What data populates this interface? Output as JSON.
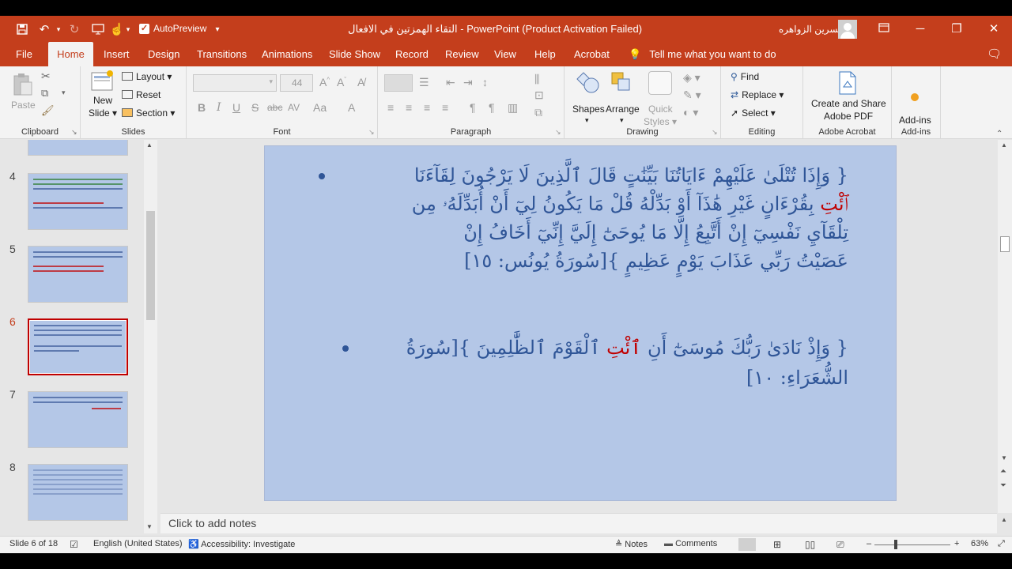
{
  "titlebar": {
    "autopreview_label": "AutoPreview",
    "document_title": "التقاء الهمزتين في الافعال  -  PowerPoint (Product Activation Failed)",
    "user_name": "نسرين الزواهره"
  },
  "tabs": [
    "File",
    "Home",
    "Insert",
    "Design",
    "Transitions",
    "Animations",
    "Slide Show",
    "Record",
    "Review",
    "View",
    "Help",
    "Acrobat"
  ],
  "tell_me": "Tell me what you want to do",
  "ribbon": {
    "clipboard": {
      "label": "Clipboard",
      "paste": "Paste"
    },
    "slides": {
      "label": "Slides",
      "new_slide": "New",
      "new_slide2": "Slide",
      "layout": "Layout",
      "reset": "Reset",
      "section": "Section"
    },
    "font": {
      "label": "Font",
      "size": "44",
      "bold": "B",
      "italic": "I",
      "underline": "U",
      "strike": "S",
      "shadow": "abc",
      "spacing": "AV",
      "case": "Aa",
      "color": "A"
    },
    "paragraph": {
      "label": "Paragraph"
    },
    "drawing": {
      "label": "Drawing",
      "shapes": "Shapes",
      "arrange": "Arrange",
      "quick_styles": "Quick",
      "quick_styles2": "Styles"
    },
    "editing": {
      "label": "Editing",
      "find": "Find",
      "replace": "Replace",
      "select": "Select"
    },
    "adobe": {
      "label": "Adobe Acrobat",
      "create_share": "Create and Share",
      "adobe_pdf": "Adobe PDF"
    },
    "addins": {
      "label": "Add-ins",
      "addins_btn": "Add-ins"
    }
  },
  "thumbnails": [
    {
      "num": "4"
    },
    {
      "num": "5"
    },
    {
      "num": "6"
    },
    {
      "num": "7"
    },
    {
      "num": "8"
    }
  ],
  "slide": {
    "verse1_l1": "{ وَإِذَا تُتْلَىٰ عَلَيْهِمْ ءَايَاتُنَا بَيِّنَٰتٍ قَالَ ٱلَّذِينَ لَا يَرْجُونَ لِقَآءَنَا",
    "verse1_l2_red": "ٱئْتِ",
    "verse1_l2": "بِقُرْءَانٍ غَيْرِ هَٰذَآ أَوْ بَدِّلْهُ قُلْ مَا يَكُونُ لِيٓ أَنْ أُبَدِّلَهُۥ مِن",
    "verse1_l3": "تِلْقَآيِ نَفْسِيٓ إِنْ أَتَّبِعُ إِلَّا مَا يُوحَىٰٓ إِلَيَّ إِنِّيٓ أَخَافُ إِنْ",
    "verse1_l4": "عَصَيْتُ رَبِّي عَذَابَ يَوْمٍ عَظِيمٍ }[سُورَةُ يُونُس: ١٥]",
    "verse2_l1a": "{ وَإِذْ نَادَىٰ رَبُّكَ مُوسَىٰٓ أَنِ",
    "verse2_l1_red": "ٱئْتِ",
    "verse2_l1b": "ٱلْقَوْمَ ٱلظَّٰلِمِينَ }[سُورَةُ",
    "verse2_l2": "الشُّعَرَاءِ: ١٠]"
  },
  "notes_placeholder": "Click to add notes",
  "statusbar": {
    "slide_count": "Slide 6 of 18",
    "language": "English (United States)",
    "accessibility": "Accessibility: Investigate",
    "notes": "Notes",
    "comments": "Comments",
    "zoom": "63%"
  },
  "colors": {
    "accent": "#c43e1c",
    "slide_bg": "#b4c7e7",
    "text_blue": "#2f5597",
    "text_red": "#c00000"
  }
}
